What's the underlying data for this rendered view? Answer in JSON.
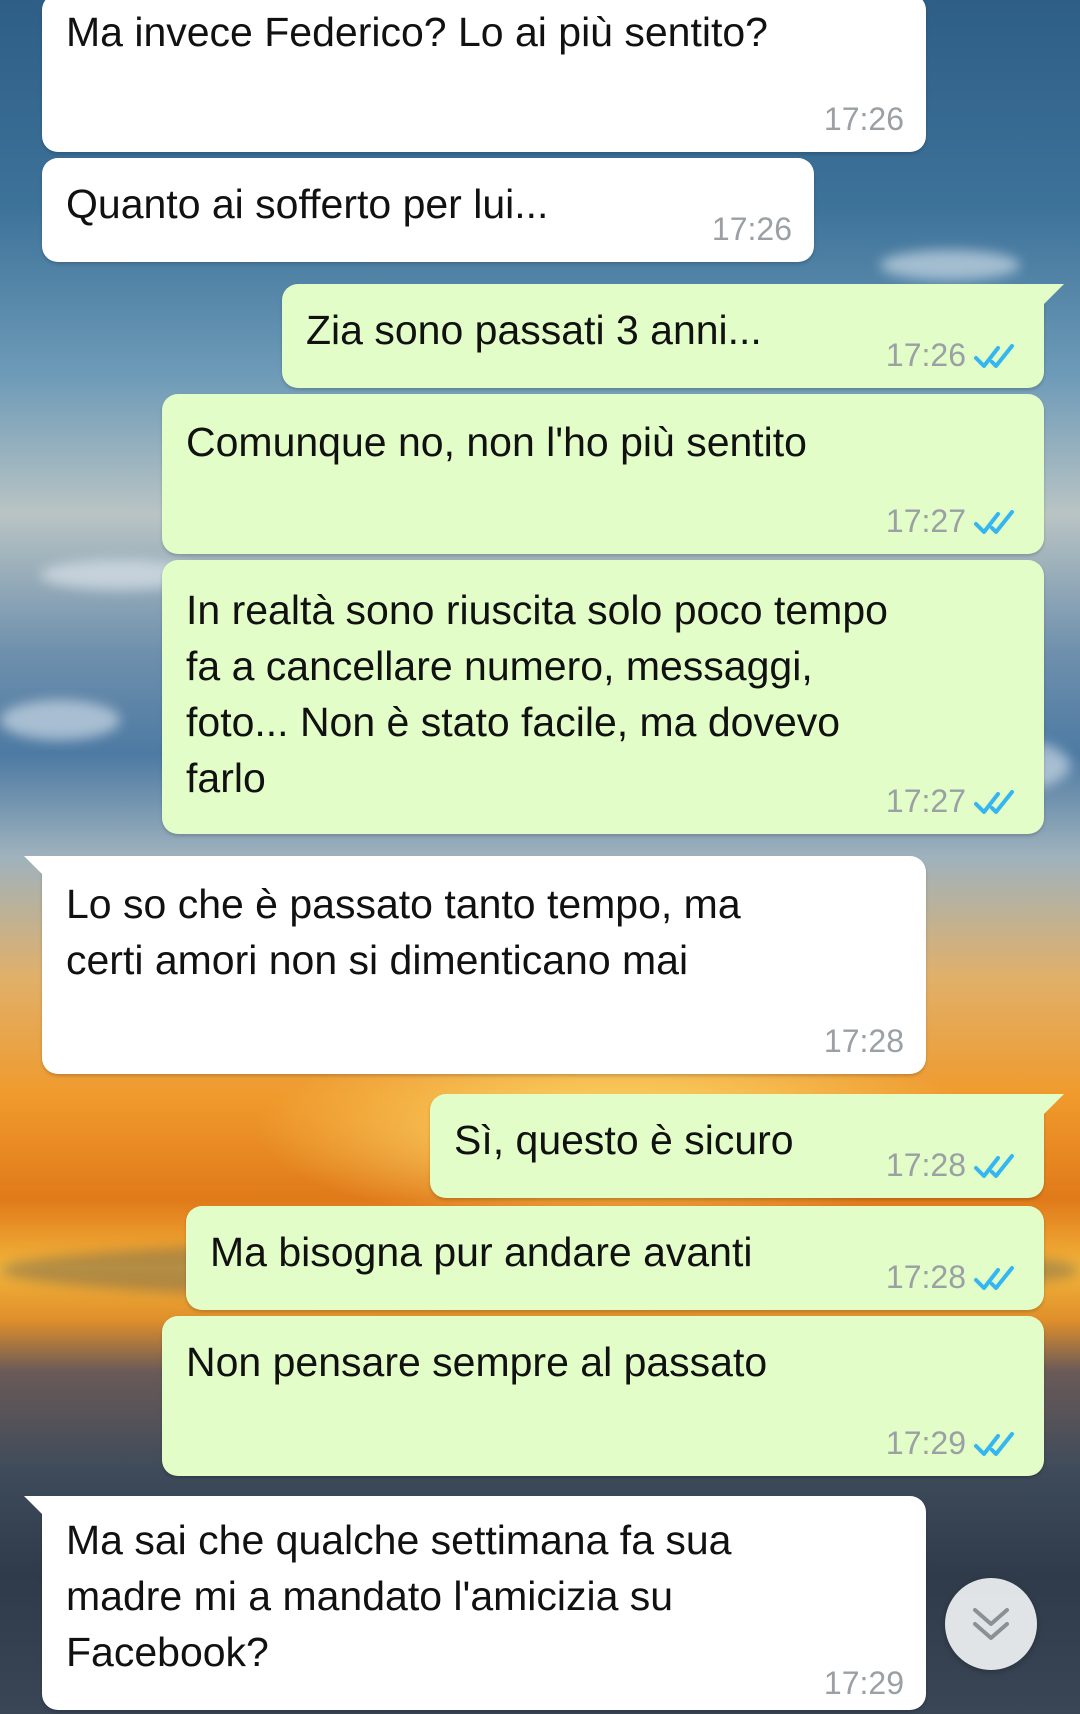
{
  "messages": [
    {
      "direction": "in",
      "text": "Ma invece Federico? Lo ai più sentito?",
      "time": "17:26",
      "status": ""
    },
    {
      "direction": "in",
      "text": "Quanto ai sofferto per lui...",
      "time": "17:26",
      "status": ""
    },
    {
      "direction": "out",
      "text": "Zia sono passati 3 anni...",
      "time": "17:26",
      "status": "read"
    },
    {
      "direction": "out",
      "text": "Comunque no, non l'ho più sentito",
      "time": "17:27",
      "status": "read"
    },
    {
      "direction": "out",
      "text": "In realtà sono riuscita solo poco tempo\nfa a cancellare numero, messaggi,\nfoto... Non è stato facile, ma dovevo\nfarlo",
      "time": "17:27",
      "status": "read"
    },
    {
      "direction": "in",
      "text": "Lo so che è passato tanto tempo, ma\ncerti amori non si dimenticano mai",
      "time": "17:28",
      "status": ""
    },
    {
      "direction": "out",
      "text": "Sì, questo è sicuro",
      "time": "17:28",
      "status": "read"
    },
    {
      "direction": "out",
      "text": "Ma bisogna pur andare avanti",
      "time": "17:28",
      "status": "read"
    },
    {
      "direction": "out",
      "text": "Non pensare sempre al passato",
      "time": "17:29",
      "status": "read"
    },
    {
      "direction": "in",
      "text": "Ma sai che qualche settimana fa sua\nmadre mi a mandato l'amicizia su\nFacebook?",
      "time": "17:29",
      "status": ""
    }
  ],
  "colors": {
    "incoming_bubble": "#ffffff",
    "outgoing_bubble": "#e2fdc8",
    "read_ticks": "#34b7f1",
    "timestamp": "#9aa0a3"
  },
  "icons": {
    "read_receipt": "double-check-icon",
    "scroll_down": "double-chevron-down-icon"
  }
}
